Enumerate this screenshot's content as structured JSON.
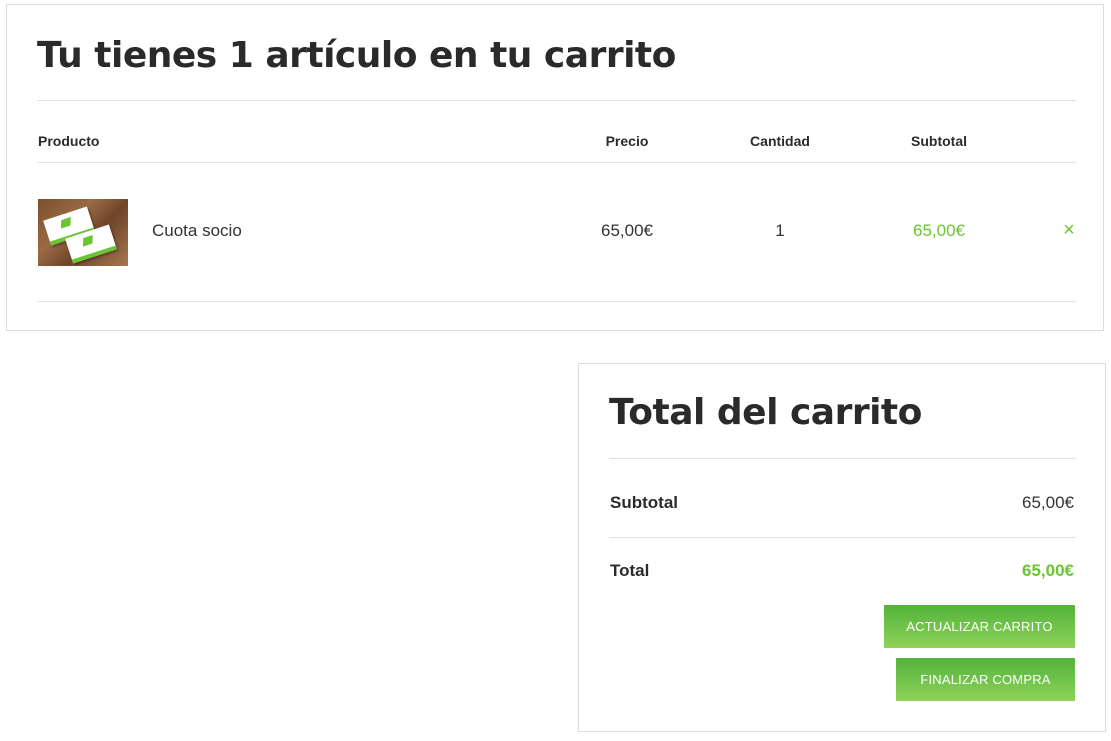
{
  "cart": {
    "title": "Tu tienes 1 artículo en tu carrito",
    "columns": {
      "product": "Producto",
      "price": "Precio",
      "quantity": "Cantidad",
      "subtotal": "Subtotal"
    },
    "items": [
      {
        "name": "Cuota socio",
        "price": "65,00€",
        "quantity": "1",
        "subtotal": "65,00€",
        "remove_icon": "×"
      }
    ]
  },
  "totals": {
    "title": "Total del carrito",
    "subtotal_label": "Subtotal",
    "subtotal_value": "65,00€",
    "total_label": "Total",
    "total_value": "65,00€",
    "update_button": "ACTUALIZAR CARRITO",
    "checkout_button": "FINALIZAR COMPRA"
  },
  "colors": {
    "accent": "#6cc432",
    "text": "#2b2b2b",
    "border": "#dcdcdc"
  }
}
